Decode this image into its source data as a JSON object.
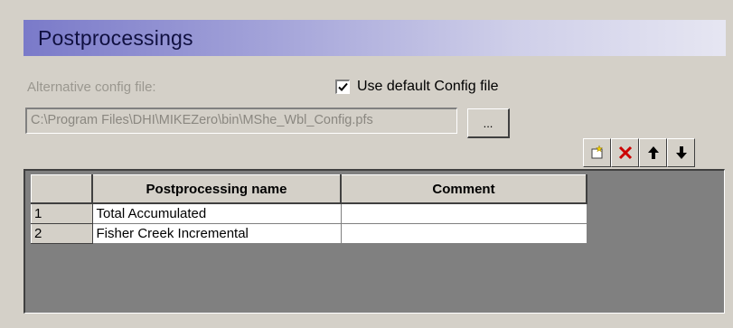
{
  "header": {
    "title": "Postprocessings"
  },
  "config": {
    "alt_label": "Alternative config file:",
    "use_default_label": "Use default Config file",
    "use_default_checked": true,
    "path": "C:\\Program Files\\DHI\\MIKEZero\\bin\\MShe_Wbl_Config.pfs",
    "browse_label": "..."
  },
  "toolbar": {
    "icons": [
      "new-row-icon",
      "delete-icon",
      "move-up-icon",
      "move-down-icon"
    ]
  },
  "table": {
    "columns": [
      "Postprocessing name",
      "Comment"
    ],
    "rows": [
      {
        "num": "1",
        "name": "Total Accumulated",
        "comment": ""
      },
      {
        "num": "2",
        "name": "Fisher Creek Incremental",
        "comment": ""
      }
    ]
  },
  "colors": {
    "banner_start": "#7a7ac9",
    "banner_end": "#e6e6f2",
    "delete_red": "#cc0000"
  }
}
